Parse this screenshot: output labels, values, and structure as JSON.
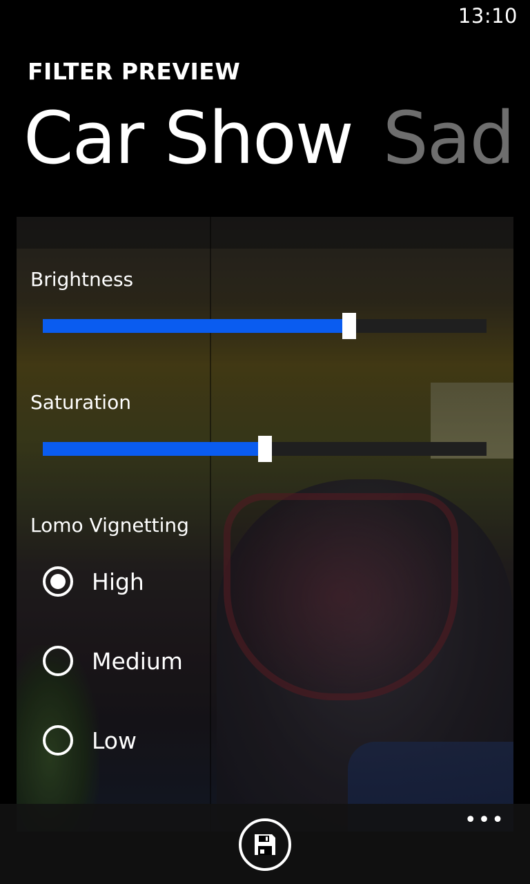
{
  "status_bar": {
    "time": "13:10"
  },
  "header": {
    "app_title": "FILTER PREVIEW"
  },
  "pivot": {
    "items": [
      {
        "label": "Car Show",
        "active": true
      },
      {
        "label": "Sad",
        "active": false
      }
    ]
  },
  "controls": {
    "brightness": {
      "label": "Brightness",
      "value": 0.69
    },
    "saturation": {
      "label": "Saturation",
      "value": 0.5
    },
    "vignetting": {
      "label": "Lomo Vignetting",
      "options": [
        {
          "label": "High",
          "selected": true
        },
        {
          "label": "Medium",
          "selected": false
        },
        {
          "label": "Low",
          "selected": false
        }
      ]
    }
  },
  "app_bar": {
    "primary_icon": "save-icon",
    "more_label": "•••"
  },
  "colors": {
    "accent": "#0a5cf0",
    "background": "#000000",
    "track": "#1f1f1f"
  }
}
